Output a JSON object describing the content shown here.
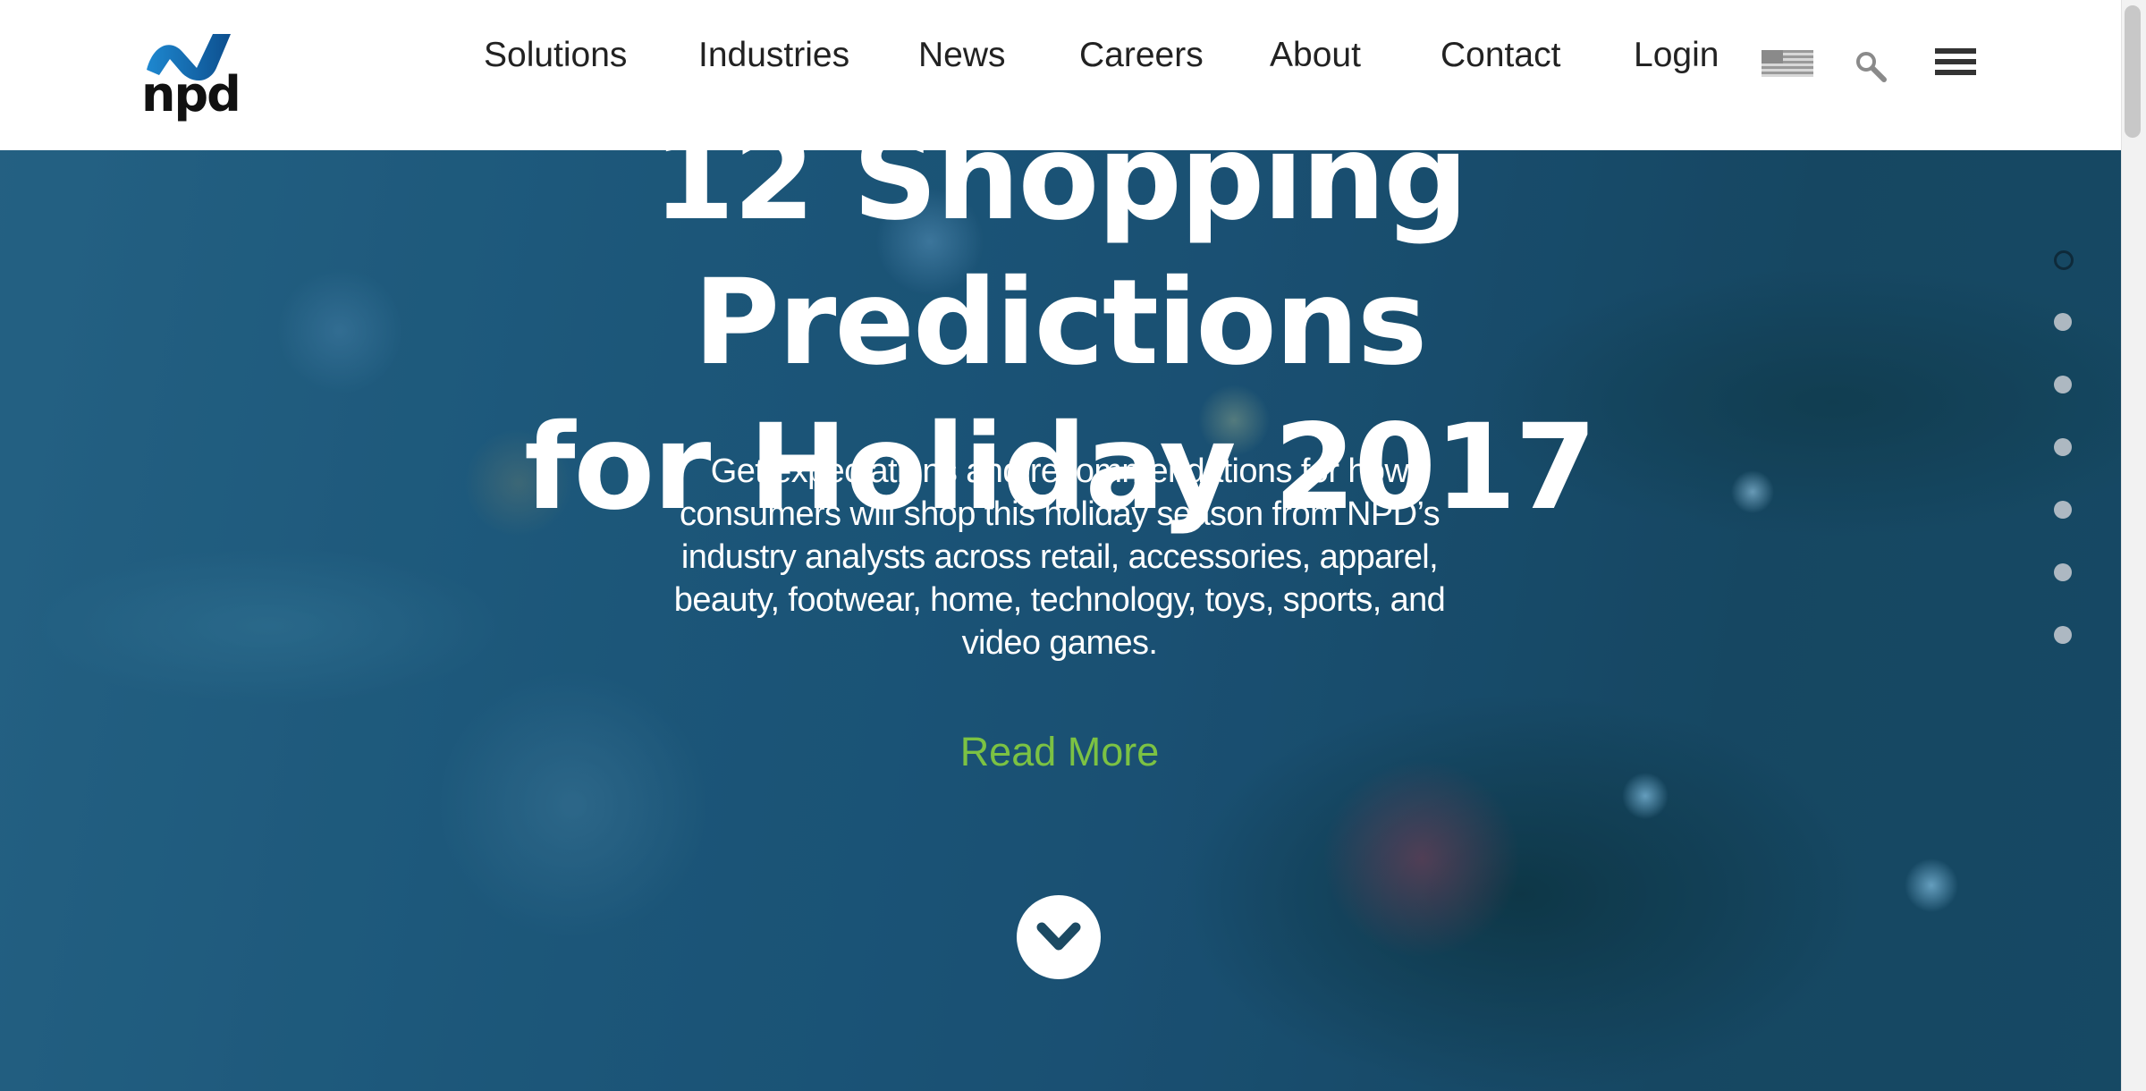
{
  "header": {
    "logo_text": "npd",
    "nav": [
      {
        "label": "Solutions"
      },
      {
        "label": "Industries"
      },
      {
        "label": "News"
      },
      {
        "label": "Careers"
      },
      {
        "label": "About"
      },
      {
        "label": "Contact"
      },
      {
        "label": "Login"
      }
    ],
    "icons": [
      "us-flag-icon",
      "search-icon",
      "hamburger-menu-icon"
    ]
  },
  "hero": {
    "headline_line1": "12 Shopping Predictions",
    "headline_line2": "for Holiday 2017",
    "description": "Get expectations and recommendations for how consumers will shop this holiday season from NPD’s industry analysts across retail, accessories, apparel, beauty, footwear, home, technology, toys, sports, and video games.",
    "read_more": "Read More",
    "slide_count": 7,
    "active_slide": 1
  },
  "colors": {
    "accent_green": "#7cc243",
    "logo_blue": "#1a6fb0",
    "header_bg": "#ffffff",
    "text_white": "#ffffff"
  }
}
